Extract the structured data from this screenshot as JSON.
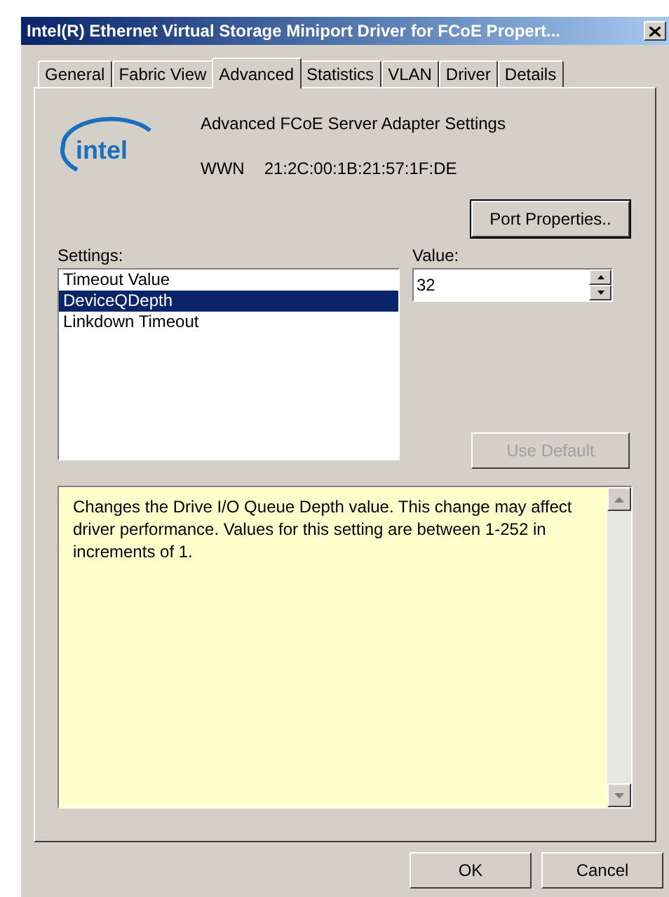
{
  "window": {
    "title": "Intel(R) Ethernet Virtual Storage Miniport Driver for FCoE Propert..."
  },
  "tabs": [
    {
      "label": "General",
      "selected": false
    },
    {
      "label": "Fabric View",
      "selected": false
    },
    {
      "label": "Advanced",
      "selected": true
    },
    {
      "label": "Statistics",
      "selected": false
    },
    {
      "label": "VLAN",
      "selected": false
    },
    {
      "label": "Driver",
      "selected": false
    },
    {
      "label": "Details",
      "selected": false
    }
  ],
  "header": {
    "logo": "intel",
    "title": "Advanced FCoE Server Adapter Settings",
    "wwn_label": "WWN",
    "wwn_value": "21:2C:00:1B:21:57:1F:DE"
  },
  "port_properties_button": {
    "label": "Port Properties..",
    "disabled": false
  },
  "settings": {
    "label": "Settings:",
    "items": [
      {
        "label": "Timeout Value",
        "selected": false
      },
      {
        "label": "DeviceQDepth",
        "selected": true
      },
      {
        "label": "Linkdown Timeout",
        "selected": false
      }
    ]
  },
  "value": {
    "label": "Value:",
    "value": "32"
  },
  "use_default_button": {
    "label": "Use Default",
    "disabled": true
  },
  "description": "Changes the Drive I/O Queue Depth value. This change may affect driver performance. Values for this setting are between 1-252 in increments of 1.",
  "buttons": [
    {
      "label": "OK"
    },
    {
      "label": "Cancel"
    }
  ]
}
